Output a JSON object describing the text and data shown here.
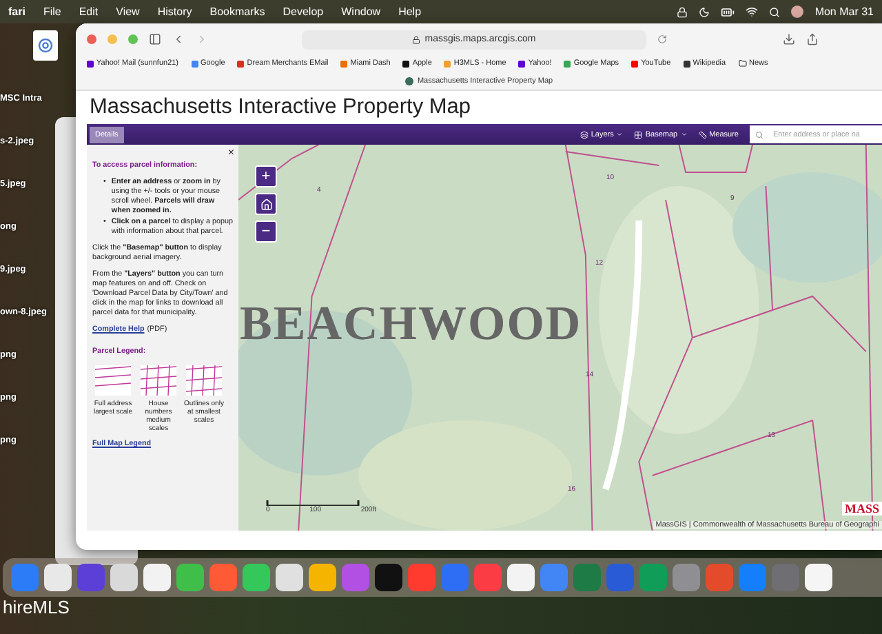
{
  "menu_bar": {
    "app": "fari",
    "items": [
      "File",
      "Edit",
      "View",
      "History",
      "Bookmarks",
      "Develop",
      "Window",
      "Help"
    ],
    "clock": "Mon Mar 31"
  },
  "desktop": {
    "files": [
      "MSC Intra",
      "s-2.jpeg",
      "5.jpeg",
      "ong",
      "9.jpeg",
      "own-8.jpeg",
      "png",
      "png",
      "png"
    ],
    "corner_label": "hireMLS"
  },
  "browser": {
    "url": "massgis.maps.arcgis.com",
    "tab": "Massachusetts Interactive Property Map",
    "bookmarks": [
      {
        "label": "Yahoo! Mail (sunnfun21)",
        "color": "#6001d2"
      },
      {
        "label": "Google",
        "color": "#4285f4"
      },
      {
        "label": "Dream Merchants EMail",
        "color": "#d93025"
      },
      {
        "label": "Miami Dash",
        "color": "#e8710a"
      },
      {
        "label": "Apple",
        "color": "#111111"
      },
      {
        "label": "H3MLS - Home",
        "color": "#f0a030"
      },
      {
        "label": "Yahoo!",
        "color": "#6001d2"
      },
      {
        "label": "Google Maps",
        "color": "#34a853"
      },
      {
        "label": "YouTube",
        "color": "#ff0000"
      },
      {
        "label": "Wikipedia",
        "color": "#333333"
      }
    ],
    "folder": "News"
  },
  "page": {
    "title": "Massachusetts Interactive Property Map",
    "toolbar": {
      "details": "Details",
      "layers": "Layers",
      "basemap": "Basemap",
      "measure": "Measure",
      "search_placeholder": "Enter address or place na"
    },
    "panel": {
      "close": "×",
      "bullet_marker": "•",
      "heading": "To access parcel information:",
      "bullets": [
        "**Enter an address** or **zoom in** by using the +/- tools or your mouse scroll wheel. **Parcels will draw when zoomed in.**",
        "**Click on a parcel** to display a popup with information about that parcel."
      ],
      "paragraphs": [
        "Click the **\"Basemap\" button** to display background aerial imagery.",
        "From the **\"Layers\" button** you can turn map features on and off. Check on 'Download Parcel Data by City/Town' and click in the map for links to download all parcel data for that municipality."
      ],
      "help_link": "Complete Help",
      "help_note": "(PDF)",
      "legend_heading": "Parcel Legend:",
      "legend": [
        {
          "caption": "Full address largest scale"
        },
        {
          "caption": "House numbers medium scales"
        },
        {
          "caption": "Outlines only at smallest scales"
        }
      ],
      "legend_link": "Full Map Legend"
    },
    "map": {
      "zoom_in": "+",
      "zoom_out": "−",
      "place_label": "BEACHWOOD",
      "parcels": [
        "4",
        "10",
        "9",
        "12",
        "14",
        "13",
        "16"
      ],
      "scale": [
        "0",
        "100",
        "200ft"
      ],
      "logo": "MASS",
      "attribution": "MassGIS | Commonwealth of Massachusetts Bureau of Geographi"
    }
  },
  "dock": {
    "apps": [
      {
        "color": "#2b7cf6"
      },
      {
        "color": "#e8e8e8"
      },
      {
        "color": "#5b3fd6"
      },
      {
        "color": "#d9d9d9"
      },
      {
        "color": "#f2f2f2"
      },
      {
        "color": "#3fbf4a"
      },
      {
        "color": "#ff5a36"
      },
      {
        "color": "#34c759"
      },
      {
        "color": "#e0e0e0"
      },
      {
        "color": "#f4b400"
      },
      {
        "color": "#b150e2"
      },
      {
        "color": "#111111"
      },
      {
        "color": "#ff3b30"
      },
      {
        "color": "#2e6ef5"
      },
      {
        "color": "#fc3c44"
      },
      {
        "color": "#f3f3f3"
      },
      {
        "color": "#4285f4"
      },
      {
        "color": "#1e7b45"
      },
      {
        "color": "#2a5bd7"
      },
      {
        "color": "#0f9d58"
      },
      {
        "color": "#8e8e93"
      },
      {
        "color": "#e34b2a"
      },
      {
        "color": "#147efb"
      },
      {
        "color": "#6e6e73"
      },
      {
        "color": "#f5f5f5"
      }
    ]
  }
}
